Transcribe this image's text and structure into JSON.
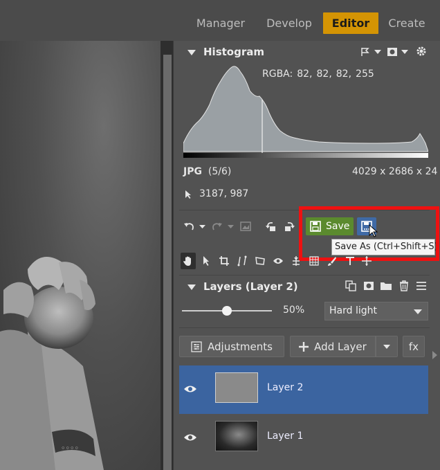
{
  "nav": {
    "tabs": [
      {
        "label": "Manager",
        "active": false
      },
      {
        "label": "Develop",
        "active": false
      },
      {
        "label": "Editor",
        "active": true
      },
      {
        "label": "Create",
        "active": false
      }
    ]
  },
  "histogram": {
    "title": "Histogram",
    "rgba_label": "RGBA:",
    "rgba_values": [
      "82,",
      "82,",
      "82,",
      "255"
    ],
    "format": "JPG",
    "file_index": "(5/6)",
    "dimensions": "4029 x 2686 x 24",
    "cursor_coords": "3187, 987"
  },
  "toolbar": {
    "save_label": "Save",
    "save_as_tooltip": "Save As (Ctrl+Shift+S)"
  },
  "layers": {
    "title": "Layers (Layer 2)",
    "opacity_value": 0.5,
    "opacity_label": "50%",
    "blend_mode": "Hard light",
    "adjustments_label": "Adjustments",
    "add_layer_label": "Add Layer",
    "fx_label": "fx",
    "items": [
      {
        "name": "Layer 2",
        "selected": true
      },
      {
        "name": "Layer 1",
        "selected": false
      }
    ]
  },
  "colors": {
    "accent_tab": "#d49404",
    "save_green": "#5b8a2e",
    "save_as_blue": "#3f6aa6",
    "selected_layer": "#3b64a0",
    "highlight_red": "#ee1111"
  }
}
